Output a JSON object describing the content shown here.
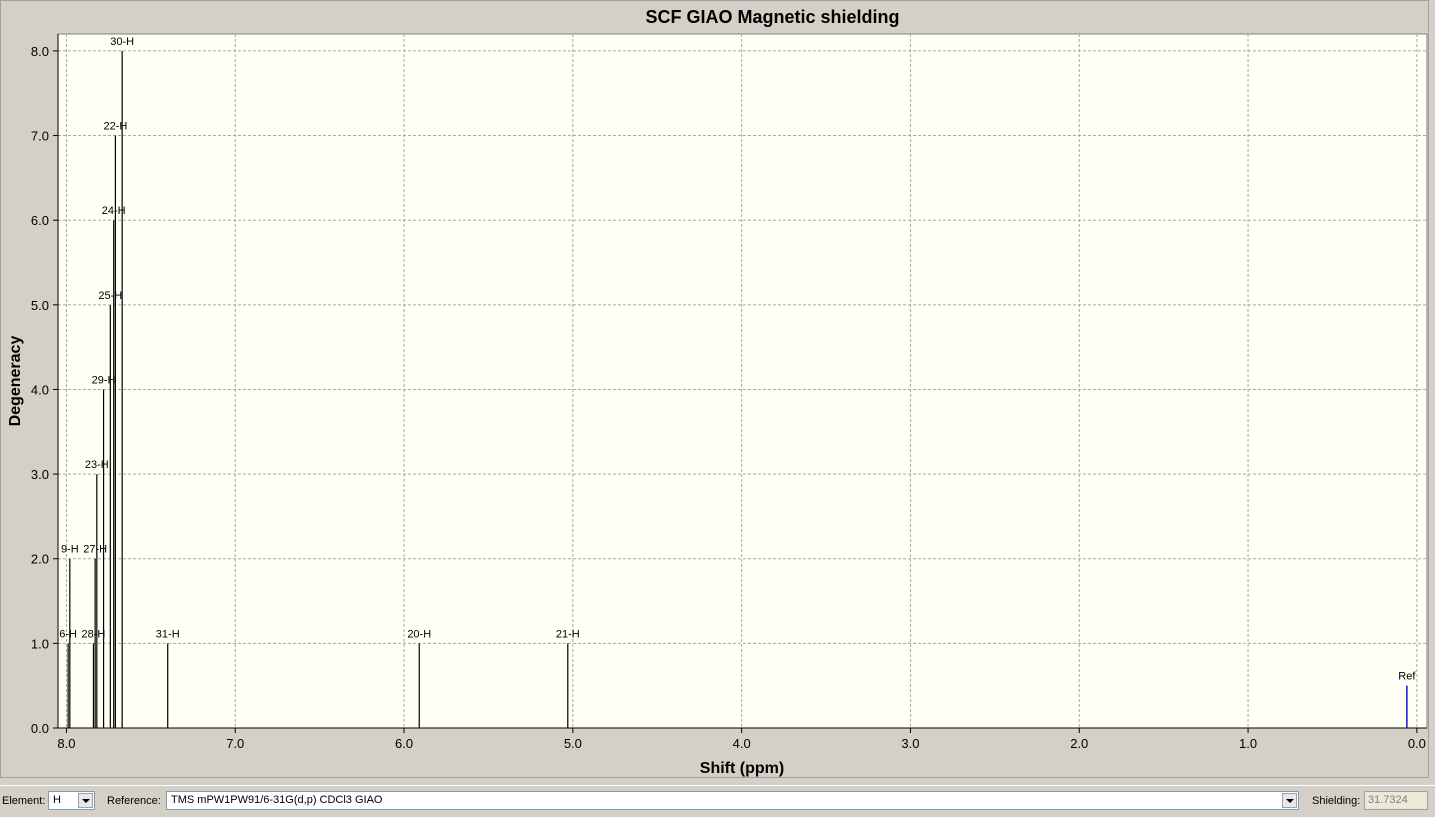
{
  "chart_data": {
    "type": "stem",
    "title": "SCF GIAO Magnetic shielding",
    "xlabel": "Shift (ppm)",
    "ylabel": "Degeneracy",
    "xlim": [
      8.05,
      -0.06
    ],
    "ylim": [
      0,
      8.2
    ],
    "x_reversed": true,
    "grid": true,
    "xticks": [
      "8.0",
      "7.0",
      "6.0",
      "5.0",
      "4.0",
      "3.0",
      "2.0",
      "1.0",
      "0.0"
    ],
    "yticks": [
      "0.0",
      "1.0",
      "2.0",
      "3.0",
      "4.0",
      "5.0",
      "6.0",
      "7.0",
      "8.0"
    ],
    "peaks": [
      {
        "label": "6-H",
        "x": 7.99,
        "y": 1.0
      },
      {
        "label": "9-H",
        "x": 7.98,
        "y": 2.0
      },
      {
        "label": "28-H",
        "x": 7.84,
        "y": 1.0
      },
      {
        "label": "27-H",
        "x": 7.83,
        "y": 2.0
      },
      {
        "label": "23-H",
        "x": 7.82,
        "y": 3.0
      },
      {
        "label": "29-H",
        "x": 7.78,
        "y": 4.0
      },
      {
        "label": "25-H",
        "x": 7.74,
        "y": 5.0
      },
      {
        "label": "24-H",
        "x": 7.72,
        "y": 6.0
      },
      {
        "label": "22-H",
        "x": 7.71,
        "y": 7.0
      },
      {
        "label": "30-H",
        "x": 7.67,
        "y": 8.0
      },
      {
        "label": "31-H",
        "x": 7.4,
        "y": 1.0
      },
      {
        "label": "20-H",
        "x": 5.91,
        "y": 1.0
      },
      {
        "label": "21-H",
        "x": 5.03,
        "y": 1.0
      }
    ],
    "reference": {
      "label": "Ref",
      "x": 0.0,
      "y": 0.5,
      "color": "#0000cc"
    }
  },
  "controls": {
    "element_label": "Element:",
    "element_value": "H",
    "reference_label": "Reference:",
    "reference_value": "TMS mPW1PW91/6-31G(d,p) CDCl3 GIAO",
    "shielding_label": "Shielding:",
    "shielding_value": "31.7324"
  },
  "colors": {
    "plot_bg": "#fffff5",
    "stem": "#000000",
    "grid": "#a8a8a8"
  }
}
